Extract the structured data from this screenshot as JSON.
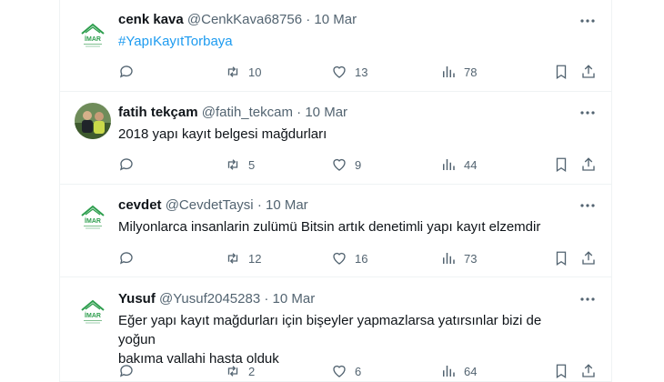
{
  "tweets": [
    {
      "name": "cenk kava",
      "handle": "@CenkKava68756",
      "dot": "·",
      "time": "10 Mar",
      "text": "#YapıKayıtTorbaya",
      "avatar_label": "İMAR",
      "stats": {
        "replies": "",
        "retweets": "10",
        "likes": "13",
        "views": "78"
      }
    },
    {
      "name": "fatih tekçam",
      "handle": "@fatih_tekcam",
      "dot": "·",
      "time": "10 Mar",
      "text": "2018 yapı kayıt belgesi mağdurları",
      "stats": {
        "replies": "",
        "retweets": "5",
        "likes": "9",
        "views": "44"
      }
    },
    {
      "name": "cevdet",
      "handle": "@CevdetTaysi",
      "dot": "·",
      "time": "10 Mar",
      "text": "Milyonlarca insanlarin zulümü Bitsin artık denetimli yapı kayıt elzemdir",
      "avatar_label": "İMAR",
      "stats": {
        "replies": "",
        "retweets": "12",
        "likes": "16",
        "views": "73"
      }
    },
    {
      "name": "Yusuf",
      "handle": "@Yusuf2045283",
      "dot": "·",
      "time": "10 Mar",
      "text_line1": "Eğer yapı kayıt mağdurları için bişeyler yapmazlarsa yatırsınlar bizi de yoğun",
      "text_line2": "bakıma vallahi hasta olduk",
      "avatar_label": "İMAR",
      "stats": {
        "replies": "",
        "retweets": "2",
        "likes": "6",
        "views": "64"
      }
    }
  ],
  "colors": {
    "accent": "#1d9bf0",
    "muted": "#536471",
    "text": "#0f1419",
    "logo_green": "#2e9e4e"
  },
  "icons": [
    "reply-icon",
    "retweet-icon",
    "like-icon",
    "views-icon",
    "bookmark-icon",
    "share-icon",
    "more-icon"
  ]
}
